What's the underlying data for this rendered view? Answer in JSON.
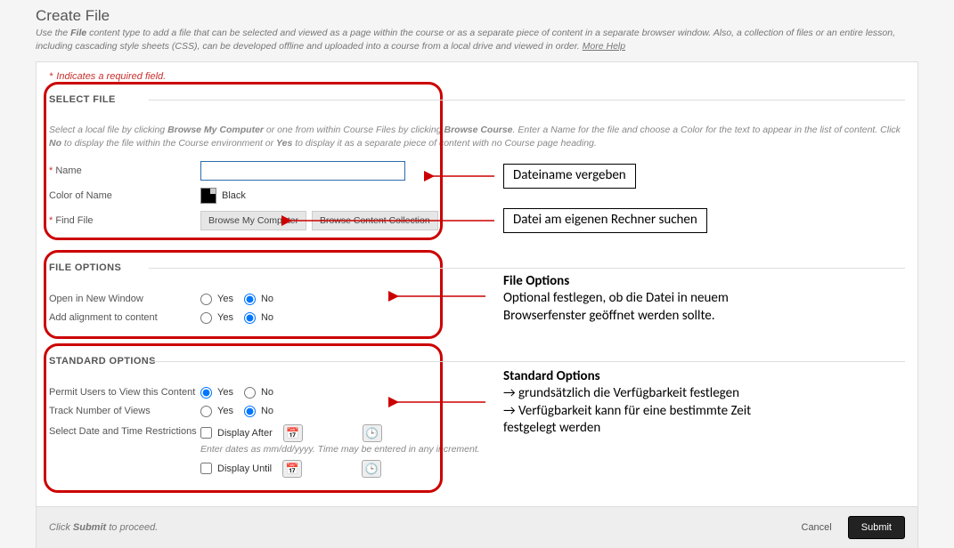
{
  "header": {
    "title": "Create File",
    "desc_pre": "Use the ",
    "desc_bold": "File",
    "desc_post": " content type to add a file that can be selected and viewed as a page within the course or as a separate piece of content in a separate browser window. Also, a collection of files or an entire lesson, including cascading style sheets (CSS), can be developed offline and uploaded into a course from a local drive and viewed in order. ",
    "more_help": "More Help"
  },
  "req_note": "Indicates a required field.",
  "select_file": {
    "legend": "SELECT FILE",
    "desc_1": "Select a local file by clicking ",
    "desc_b1": "Browse My Computer",
    "desc_2": " or one from within Course Files by clicking ",
    "desc_b2": "Browse Course",
    "desc_3": ". Enter a Name for the file and choose a Color for the text to appear in the list of content. Click ",
    "desc_b3": "No",
    "desc_4": " to display the file within the Course environment or ",
    "desc_b4": "Yes",
    "desc_5": " to display it as a separate piece of content with no Course page heading.",
    "name_label": "Name",
    "color_label": "Color of Name",
    "color_text": "Black",
    "find_label": "Find File",
    "browse_computer": "Browse My Computer",
    "browse_collection": "Browse Content Collection"
  },
  "file_options": {
    "legend": "FILE OPTIONS",
    "open_new": "Open in New Window",
    "add_align": "Add alignment to content",
    "yes": "Yes",
    "no": "No"
  },
  "standard_options": {
    "legend": "STANDARD OPTIONS",
    "permit": "Permit Users to View this Content",
    "track": "Track Number of Views",
    "restrict": "Select Date and Time Restrictions",
    "disp_after": "Display After",
    "disp_until": "Display Until",
    "hint": "Enter dates as mm/dd/yyyy. Time may be entered in any increment.",
    "yes": "Yes",
    "no": "No"
  },
  "footer": {
    "text_pre": "Click ",
    "text_bold": "Submit",
    "text_post": " to proceed.",
    "cancel": "Cancel",
    "submit": "Submit"
  },
  "annotations": {
    "a1": "Dateiname vergeben",
    "a2": "Datei am eigenen Rechner suchen",
    "a3_head": "File Options",
    "a3_l1": "Optional festlegen, ob die Datei in neuem",
    "a3_l2": "Browserfenster geöffnet werden sollte.",
    "a4_head": "Standard Options",
    "a4_l1": "→ grundsätzlich die Verfügbarkeit festlegen",
    "a4_l2": "→ Verfügbarkeit kann für eine bestimmte Zeit",
    "a4_l3": "festgelegt werden"
  }
}
